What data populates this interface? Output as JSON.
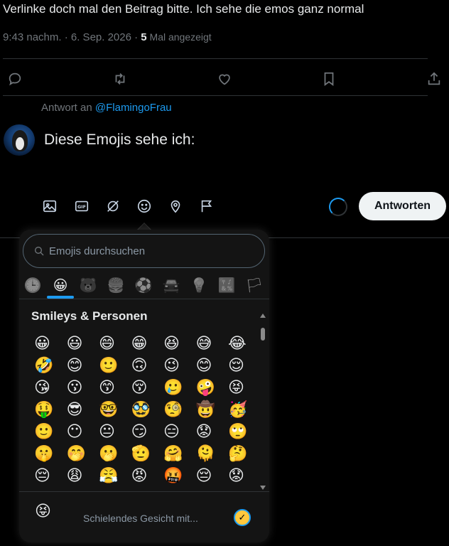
{
  "tweet": {
    "text": "Verlinke doch mal den Beitrag bitte. Ich sehe die emos ganz normal",
    "time": "9:43 nachm. · 6. Sep. 2026 · ",
    "views_count": "5",
    "views_label": " Mal angezeigt"
  },
  "actions": {
    "reply_icon": "reply-icon",
    "retweet_icon": "retweet-icon",
    "like_icon": "heart-icon",
    "bookmark_icon": "bookmark-icon",
    "share_icon": "share-icon"
  },
  "compose": {
    "reply_to_prefix": "Antwort an ",
    "reply_to_handle": "@FlamingoFrau",
    "text": "Diese Emojis sehe ich:",
    "submit_label": "Antworten",
    "tools": [
      "image-icon",
      "gif-icon",
      "grok-icon",
      "emoji-icon",
      "location-icon",
      "flag-icon"
    ]
  },
  "emoji_picker": {
    "search_placeholder": "Emojis durchsuchen",
    "categories": [
      "🕒",
      "😀",
      "🐻",
      "🍔",
      "⚽",
      "🚘",
      "💡",
      "🔣",
      "🏳"
    ],
    "active_category_index": 1,
    "section_title": "Smileys & Personen",
    "emojis": [
      "😀",
      "😃",
      "😄",
      "😁",
      "😆",
      "😅",
      "😂",
      "🤣",
      "😊",
      "🙂",
      "🙃",
      "😉",
      "😊",
      "😌",
      "😘",
      "😗",
      "😙",
      "😚",
      "🥲",
      "🤪",
      "😝",
      "🤑",
      "😎",
      "🤓",
      "🥸",
      "🧐",
      "🤠",
      "🥳",
      "🙂",
      "😶",
      "😐",
      "😏",
      "😑",
      "😟",
      "🙄",
      "🤫",
      "🤭",
      "🫢",
      "🫡",
      "🤗",
      "🫠",
      "🤔",
      "😔",
      "😩",
      "😤",
      "😡",
      "🤬",
      "😔",
      "😟",
      "😰",
      "😥",
      "😓",
      "😣",
      "😖",
      "😞",
      "😕"
    ],
    "preview_emoji": "😝",
    "preview_label": "Schielendes Gesicht mit...",
    "tone_button": "✓"
  }
}
